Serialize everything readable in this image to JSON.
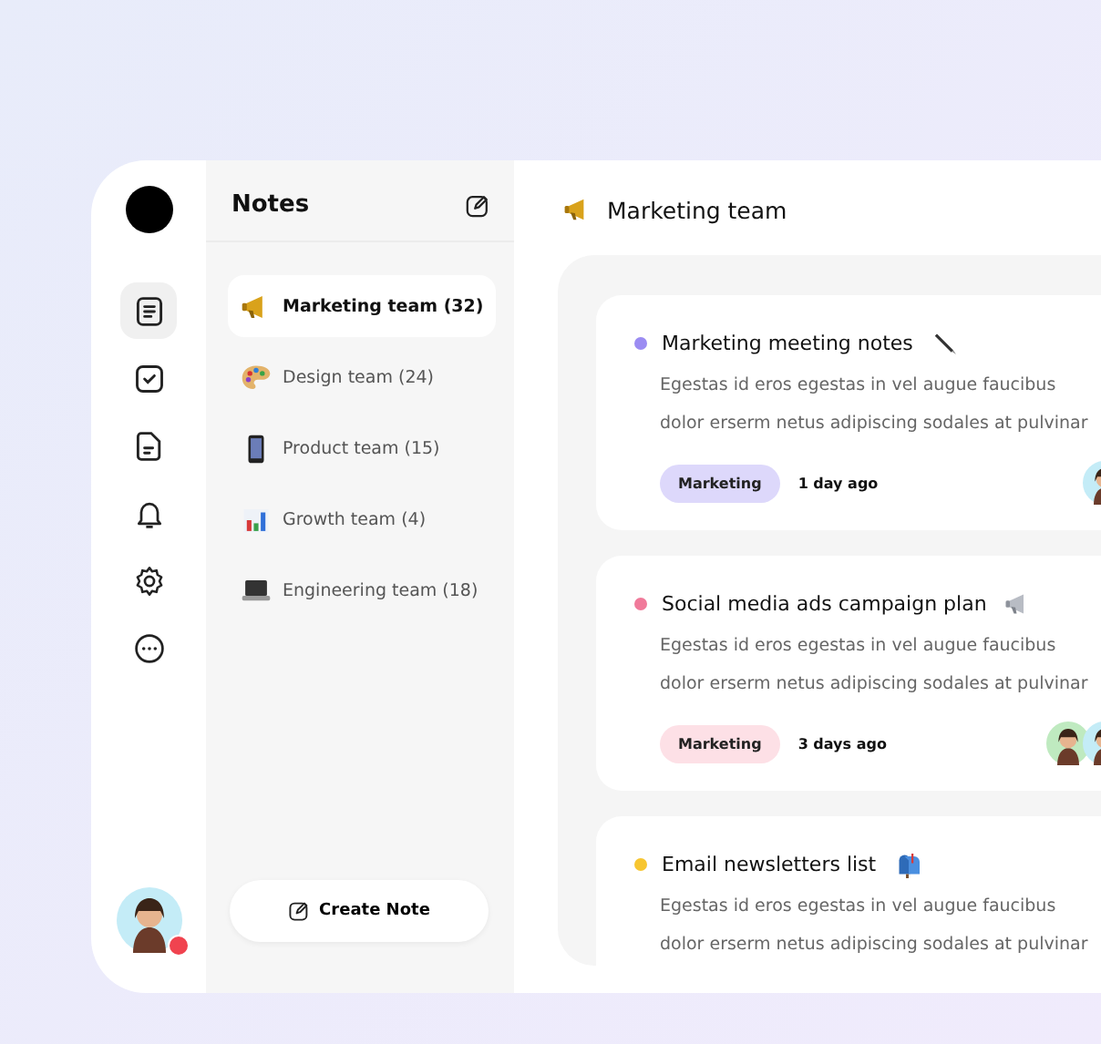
{
  "rail": {
    "items": [
      {
        "kind": "notes",
        "selected": true
      },
      {
        "kind": "tasks",
        "selected": false
      },
      {
        "kind": "docs",
        "selected": false
      },
      {
        "kind": "bell",
        "selected": false
      },
      {
        "kind": "settings",
        "selected": false
      },
      {
        "kind": "chat",
        "selected": false
      }
    ],
    "user": {
      "online": true
    }
  },
  "notes_panel": {
    "title": "Notes",
    "teams": [
      {
        "label": "Marketing team (32)",
        "selected": true
      },
      {
        "label": "Design team (24)",
        "selected": false
      },
      {
        "label": "Product team (15)",
        "selected": false
      },
      {
        "label": "Growth team (4)",
        "selected": false
      },
      {
        "label": "Engineering team (18)",
        "selected": false
      }
    ],
    "create_button": "Create Note"
  },
  "main": {
    "title": "Marketing team",
    "notes": [
      {
        "title": "Marketing meeting notes",
        "color": "#9b8cf2",
        "lines": [
          "Egestas id eros egestas in vel augue faucibus",
          "dolor erserm netus adipiscing sodales at pulvinar"
        ],
        "tag": {
          "label": "Marketing",
          "color": "#ddd8fb"
        },
        "time": "1 day ago",
        "avatars": [
          {
            "color": "#c4ecf7"
          }
        ]
      },
      {
        "title": "Social media ads campaign plan",
        "color": "#f07a9a",
        "lines": [
          "Egestas id eros egestas in vel augue faucibus",
          "dolor erserm netus adipiscing sodales at pulvinar"
        ],
        "tag": {
          "label": "Marketing",
          "color": "#fde0e6"
        },
        "time": "3 days ago",
        "avatars": [
          {
            "color": "#bfeac0"
          },
          {
            "color": "#c4ecf7"
          }
        ]
      },
      {
        "title": "Email newsletters list",
        "color": "#f7c631",
        "lines": [
          "Egestas id eros egestas in vel augue faucibus",
          "dolor erserm netus adipiscing sodales at pulvinar"
        ]
      }
    ]
  }
}
